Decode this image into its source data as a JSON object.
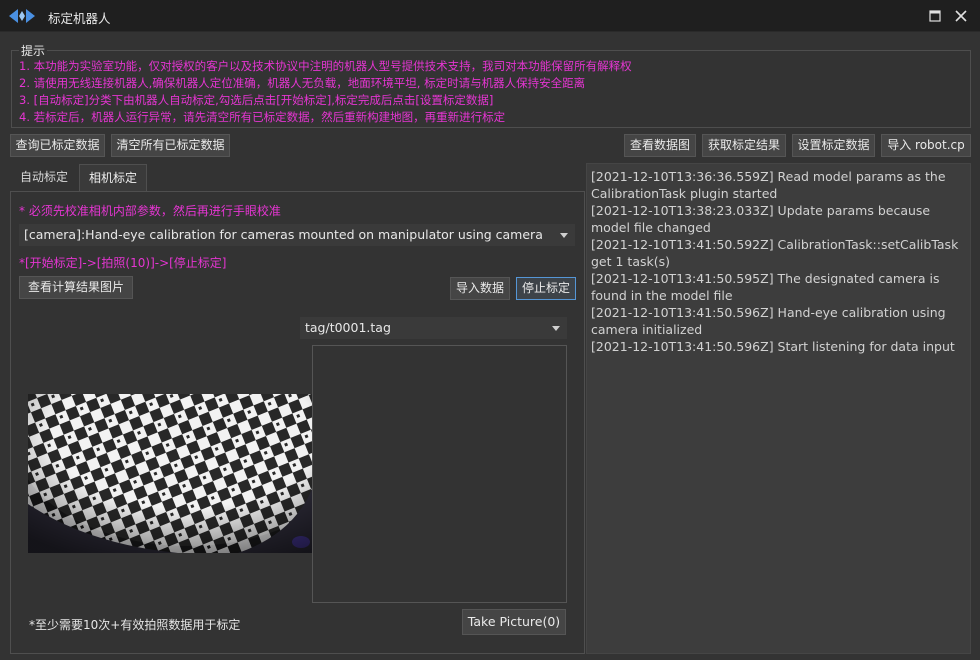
{
  "window": {
    "title": "标定机器人",
    "maximize_icon": "maximize-icon",
    "close_icon": "close-icon"
  },
  "hints": {
    "title": "提示",
    "color": "#e535d2",
    "lines": [
      "1. 本功能为实验室功能，仅对授权的客户以及技术协议中注明的机器人型号提供技术支持，我司对本功能保留所有解释权",
      "2. 请使用无线连接机器人,确保机器人定位准确，机器人无负载，地面环境平坦, 标定时请与机器人保持安全距离",
      "3. [自动标定]分类下由机器人自动标定,勾选后点击[开始标定],标定完成后点击[设置标定数据]",
      "4. 若标定后，机器人运行异常，请先清空所有已标定数据，然后重新构建地图，再重新进行标定"
    ]
  },
  "toolbar": {
    "query_label": "查询已标定数据",
    "clear_label": "清空所有已标定数据",
    "view_chart_label": "查看数据图",
    "get_result_label": "获取标定结果",
    "set_data_label": "设置标定数据",
    "import_label": "导入 robot.cp"
  },
  "tabs": {
    "auto_label": "自动标定",
    "camera_label": "相机标定",
    "selected": "相机标定"
  },
  "camera": {
    "warning": "* 必须先校准相机内部参数，然后再进行手眼校准",
    "method_selected": "[camera]:Hand-eye calibration for cameras mounted on manipulator using camera",
    "steps_hint": "*[开始标定]->[拍照(10)]->[停止标定]",
    "view_result_label": "查看计算结果图片",
    "import_data_label": "导入数据",
    "stop_label": "停止标定",
    "tag_selected": "tag/t0001.tag",
    "min_photos_note": "*至少需要10次+有效拍照数据用于标定",
    "take_picture_label": "Take Picture(0)"
  },
  "log": {
    "lines": [
      "[2021-12-10T13:36:36.559Z] Read model params as the CalibrationTask plugin started",
      "[2021-12-10T13:38:23.033Z] Update params because model file changed",
      "[2021-12-10T13:41:50.592Z] CalibrationTask::setCalibTask get 1 task(s)",
      "[2021-12-10T13:41:50.595Z] The designated camera is found in the model file",
      "[2021-12-10T13:41:50.596Z] Hand-eye calibration using camera initialized",
      "[2021-12-10T13:41:50.596Z] Start listening for data input"
    ]
  },
  "colors": {
    "background": "#333333",
    "titlebar": "#1f1f1f",
    "accent_blue": "#4a90e2",
    "hint_magenta": "#e535d2"
  }
}
